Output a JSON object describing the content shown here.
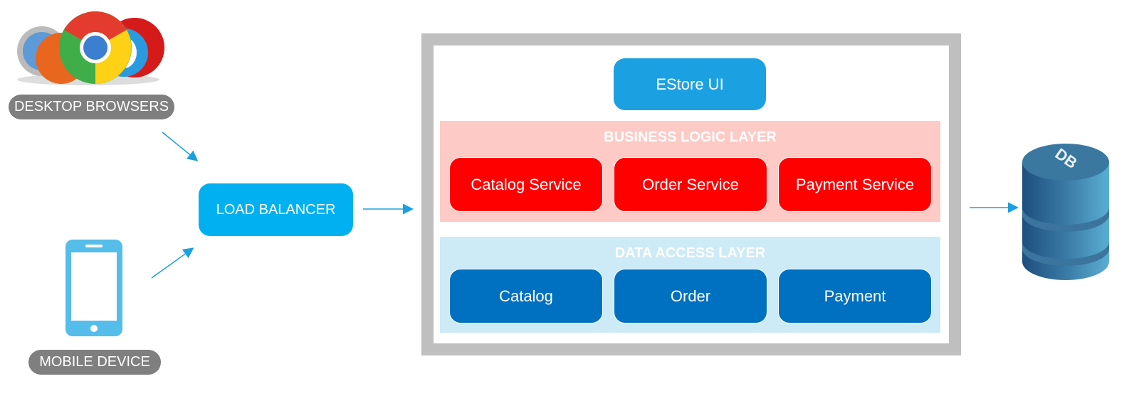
{
  "clients": {
    "desktop_label": "DESKTOP BROWSERS",
    "mobile_label": "MOBILE DEVICE",
    "desktop_icon": "browser-logos-icon",
    "mobile_icon": "smartphone-icon"
  },
  "load_balancer": {
    "label": "LOAD BALANCER",
    "color": "#00b0f0"
  },
  "app": {
    "ui": {
      "label": "EStore UI",
      "color": "#1ba1e2"
    },
    "business_layer": {
      "title": "BUSINESS LOGIC LAYER",
      "color": "#fecac5",
      "services": [
        {
          "label": "Catalog Service"
        },
        {
          "label": "Order Service"
        },
        {
          "label": "Payment Service"
        }
      ]
    },
    "data_layer": {
      "title": "DATA ACCESS LAYER",
      "color": "#cdeaf7",
      "items": [
        {
          "label": "Catalog"
        },
        {
          "label": "Order"
        },
        {
          "label": "Payment"
        }
      ]
    }
  },
  "database": {
    "label": "DB",
    "icon": "database-icon"
  },
  "colors": {
    "arrow": "#1a9fdf",
    "container_border": "#bfbfbf"
  }
}
